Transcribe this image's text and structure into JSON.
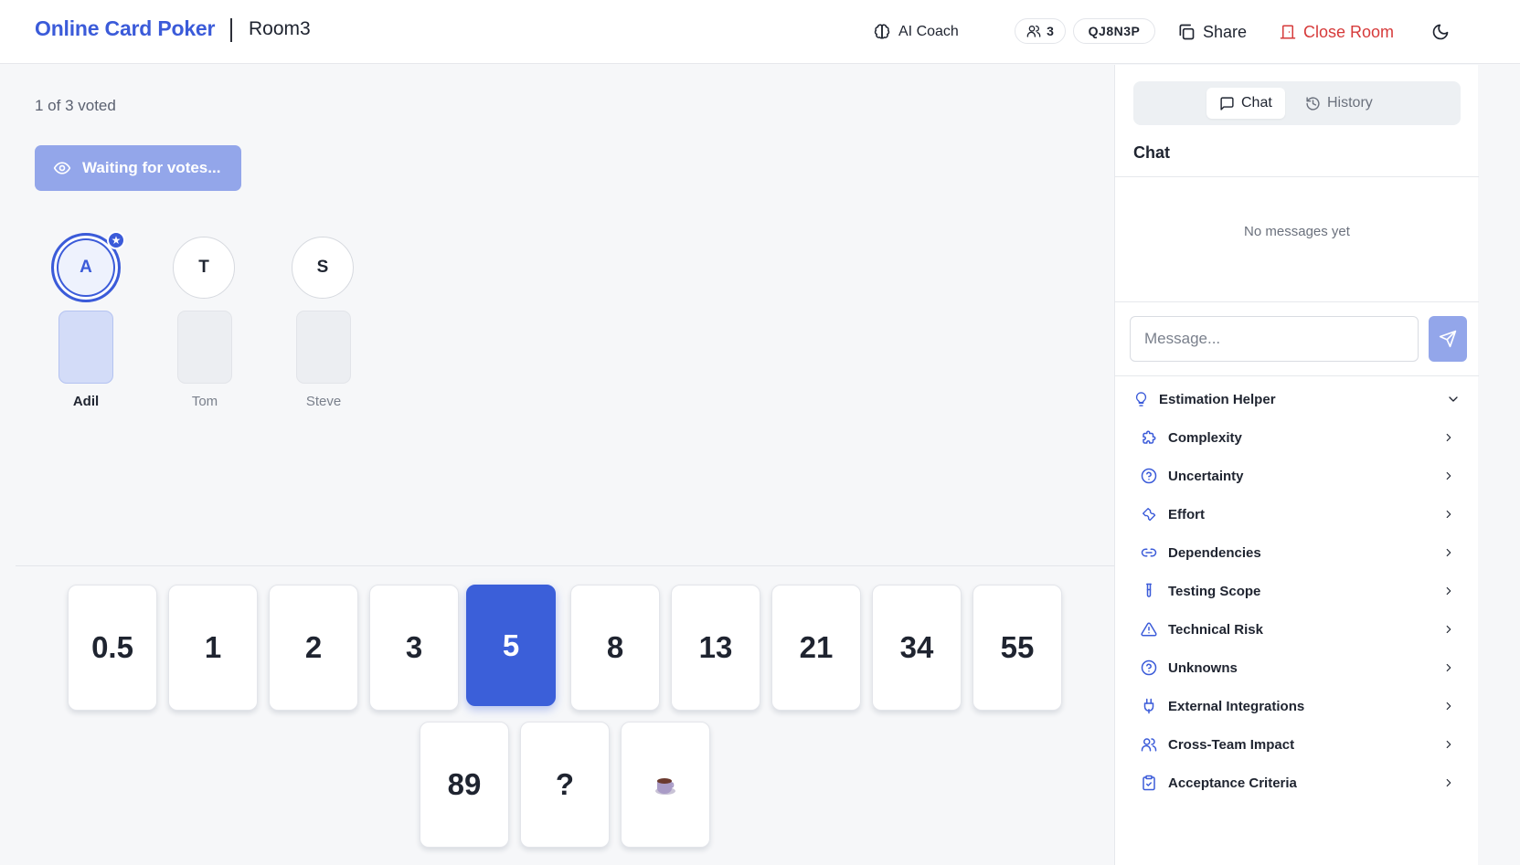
{
  "header": {
    "brand": "Online Card Poker",
    "room_name": "Room3",
    "ai_coach_label": "AI Coach",
    "participant_count": "3",
    "room_code": "QJ8N3P",
    "share_label": "Share",
    "close_room_label": "Close Room"
  },
  "main": {
    "vote_status": "1 of 3 voted",
    "reveal_button_label": "Waiting for votes...",
    "players": [
      {
        "initial": "A",
        "name": "Adil",
        "is_host": true,
        "has_voted": true
      },
      {
        "initial": "T",
        "name": "Tom",
        "is_host": false,
        "has_voted": false
      },
      {
        "initial": "S",
        "name": "Steve",
        "is_host": false,
        "has_voted": false
      }
    ],
    "cards": [
      "0.5",
      "1",
      "2",
      "3",
      "5",
      "8",
      "13",
      "21",
      "34",
      "55",
      "89",
      "?",
      "coffee"
    ],
    "selected_card": "5"
  },
  "sidebar": {
    "tabs": [
      {
        "label": "Chat",
        "active": true
      },
      {
        "label": "History",
        "active": false
      }
    ],
    "chat_title": "Chat",
    "no_messages_text": "No messages yet",
    "message_placeholder": "Message...",
    "estimation_helper_title": "Estimation Helper",
    "helper_items": [
      {
        "label": "Complexity",
        "icon": "puzzle-icon"
      },
      {
        "label": "Uncertainty",
        "icon": "question-circle-icon"
      },
      {
        "label": "Effort",
        "icon": "wrench-icon"
      },
      {
        "label": "Dependencies",
        "icon": "link-icon"
      },
      {
        "label": "Testing Scope",
        "icon": "test-tube-icon"
      },
      {
        "label": "Technical Risk",
        "icon": "warning-triangle-icon"
      },
      {
        "label": "Unknowns",
        "icon": "question-circle-icon"
      },
      {
        "label": "External Integrations",
        "icon": "plug-icon"
      },
      {
        "label": "Cross-Team Impact",
        "icon": "users-icon"
      },
      {
        "label": "Acceptance Criteria",
        "icon": "clipboard-check-icon"
      }
    ]
  },
  "colors": {
    "accent": "#3b5bd9",
    "accent_light": "#93a6ea",
    "danger": "#d63a3a"
  }
}
